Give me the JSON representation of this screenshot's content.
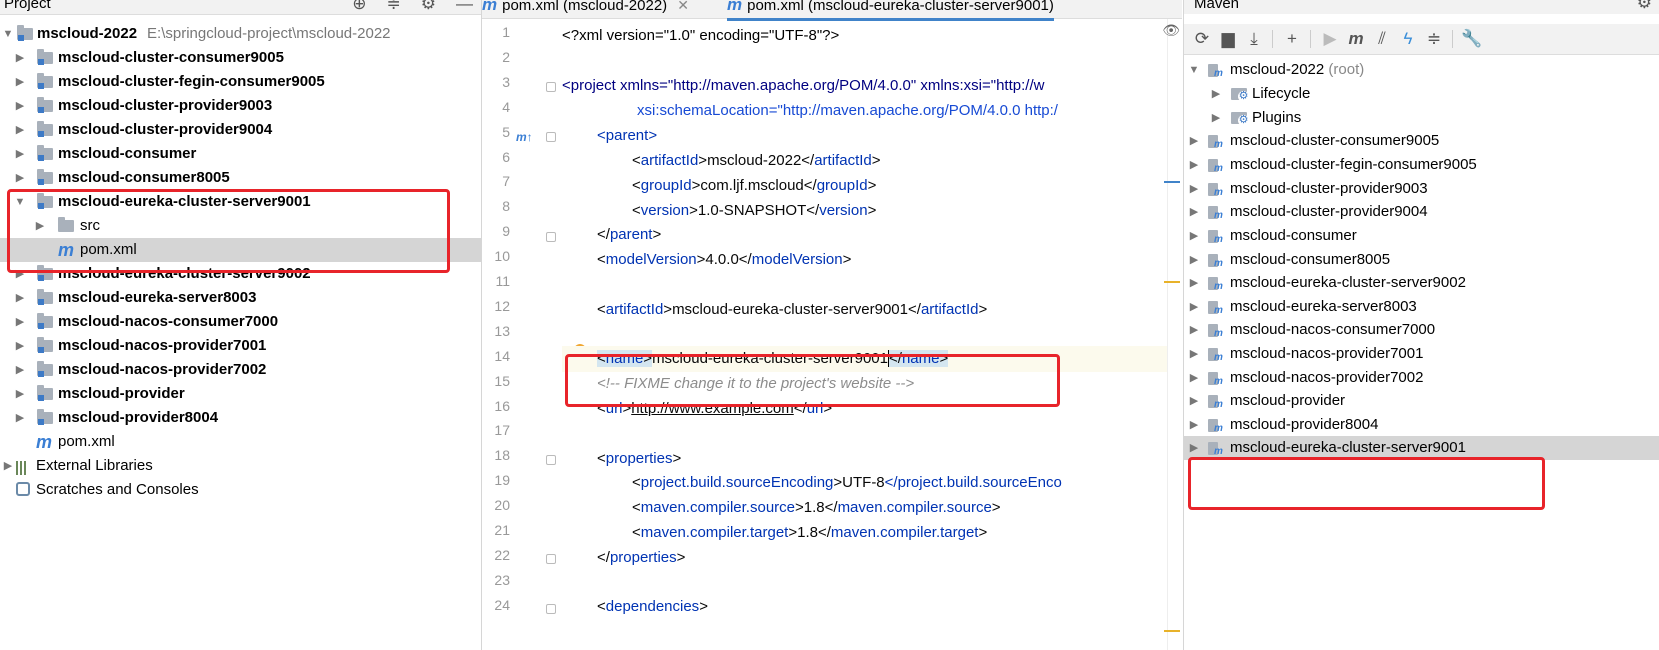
{
  "project": {
    "title": "Project",
    "root_label": "mscloud-2022",
    "root_path": "E:\\springcloud-project\\mscloud-2022",
    "items": [
      "mscloud-cluster-consumer9005",
      "mscloud-cluster-fegin-consumer9005",
      "mscloud-cluster-provider9003",
      "mscloud-cluster-provider9004",
      "mscloud-consumer",
      "mscloud-consumer8005",
      "mscloud-eureka-cluster-server9001",
      "src",
      "pom.xml",
      "mscloud-eureka-cluster-server9002",
      "mscloud-eureka-server8003",
      "mscloud-nacos-consumer7000",
      "mscloud-nacos-provider7001",
      "mscloud-nacos-provider7002",
      "mscloud-provider",
      "mscloud-provider8004",
      "pom.xml"
    ],
    "external_libraries": "External Libraries",
    "scratches": "Scratches and Consoles"
  },
  "editor": {
    "tabs": [
      "pom.xml (mscloud-2022)",
      "pom.xml (mscloud-eureka-cluster-server9001)"
    ],
    "lines": {
      "l1": "<?xml version=\"1.0\" encoding=\"UTF-8\"?>",
      "l3a": "<project xmlns=\"http://maven.apache.org/POM/4.0.0\" xmlns:xsi=\"http://w",
      "l4": "xsi:schemaLocation=\"http://maven.apache.org/POM/4.0.0 http:/",
      "l5": "parent",
      "l6_val": "mscloud-2022",
      "l7_val": "com.ljf.mscloud",
      "l8_val": "1.0-SNAPSHOT",
      "l10_val": "4.0.0",
      "l12_val": "mscloud-eureka-cluster-server9001",
      "l14_val": "mscloud-eureka-cluster-server9001",
      "l15": "<!-- FIXME change it to the project's website -->",
      "l16_val": "http://www.example.com",
      "l19_val": "UTF-8",
      "l19_close": "</project.build.sourceEnco",
      "l20_val": "1.8",
      "l21_val": "1.8"
    },
    "tags": {
      "parent": "parent",
      "artifactId": "artifactId",
      "groupId": "groupId",
      "version": "version",
      "modelVersion": "modelVersion",
      "name": "name",
      "url": "url",
      "properties": "properties",
      "sourceEncoding": "project.build.sourceEncoding",
      "compilerSource": "maven.compiler.source",
      "compilerTarget": "maven.compiler.target",
      "dependencies": "dependencies"
    },
    "line_numbers": [
      "1",
      "2",
      "3",
      "4",
      "5",
      "6",
      "7",
      "8",
      "9",
      "10",
      "11",
      "12",
      "13",
      "14",
      "15",
      "16",
      "17",
      "18",
      "19",
      "20",
      "21",
      "22",
      "23",
      "24"
    ]
  },
  "maven": {
    "title": "Maven",
    "root_label": "mscloud-2022",
    "root_suffix": "(root)",
    "lifecycle": "Lifecycle",
    "plugins": "Plugins",
    "items": [
      "mscloud-cluster-consumer9005",
      "mscloud-cluster-fegin-consumer9005",
      "mscloud-cluster-provider9003",
      "mscloud-cluster-provider9004",
      "mscloud-consumer",
      "mscloud-consumer8005",
      "mscloud-eureka-cluster-server9002",
      "mscloud-eureka-server8003",
      "mscloud-nacos-consumer7000",
      "mscloud-nacos-provider7001",
      "mscloud-nacos-provider7002",
      "mscloud-provider",
      "mscloud-provider8004",
      "mscloud-eureka-cluster-server9001"
    ]
  },
  "colors": {
    "annotation_red": "#e8242a",
    "selection": "#d5d5d5",
    "accent_blue": "#4083c9"
  }
}
